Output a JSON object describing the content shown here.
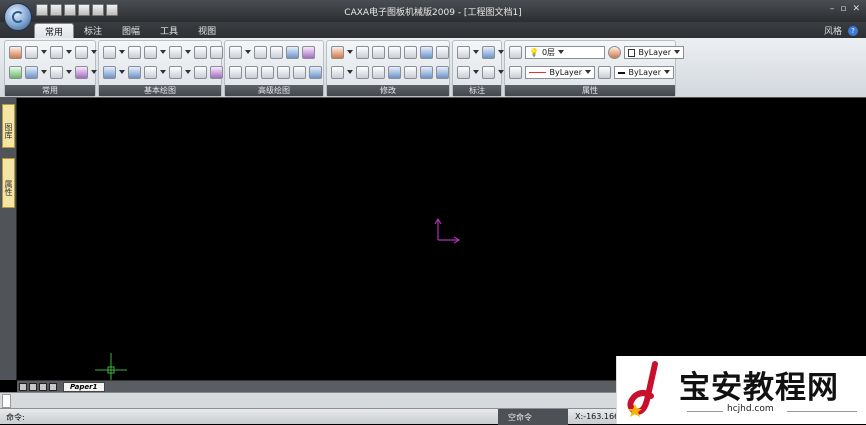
{
  "title_bar": {
    "title": "CAXA电子图板机械版2009 - [工程图文档1]",
    "style_label": "风格",
    "help_icon_text": "?",
    "minimize": "–",
    "restore": "▫",
    "close": "✕"
  },
  "tabs": [
    {
      "label": "常用",
      "active": true
    },
    {
      "label": "标注"
    },
    {
      "label": "图幅"
    },
    {
      "label": "工具"
    },
    {
      "label": "视图"
    }
  ],
  "ribbon_groups": [
    {
      "label": "常用"
    },
    {
      "label": "基本绘图"
    },
    {
      "label": "高级绘图"
    },
    {
      "label": "修改"
    },
    {
      "label": "标注"
    },
    {
      "label": "属性"
    }
  ],
  "properties": {
    "layer_value": "0层",
    "color_combo": "ByLayer",
    "linetype_combo": "ByLayer",
    "lineweight_combo": "ByLayer"
  },
  "left_panel": {
    "tab1": "图库",
    "tab2": "属性"
  },
  "layout_tabs": {
    "paper_tab": "Paper1"
  },
  "status": {
    "command_label": "命令:",
    "empty_command": "空命令",
    "coords": "X:-163.166"
  },
  "watermark": {
    "text": "宝安教程网",
    "url": "hcjhd.com"
  },
  "colors": {
    "canvas": "#000000",
    "ucs": "#b030b0",
    "cursor": "#3cb43c"
  }
}
